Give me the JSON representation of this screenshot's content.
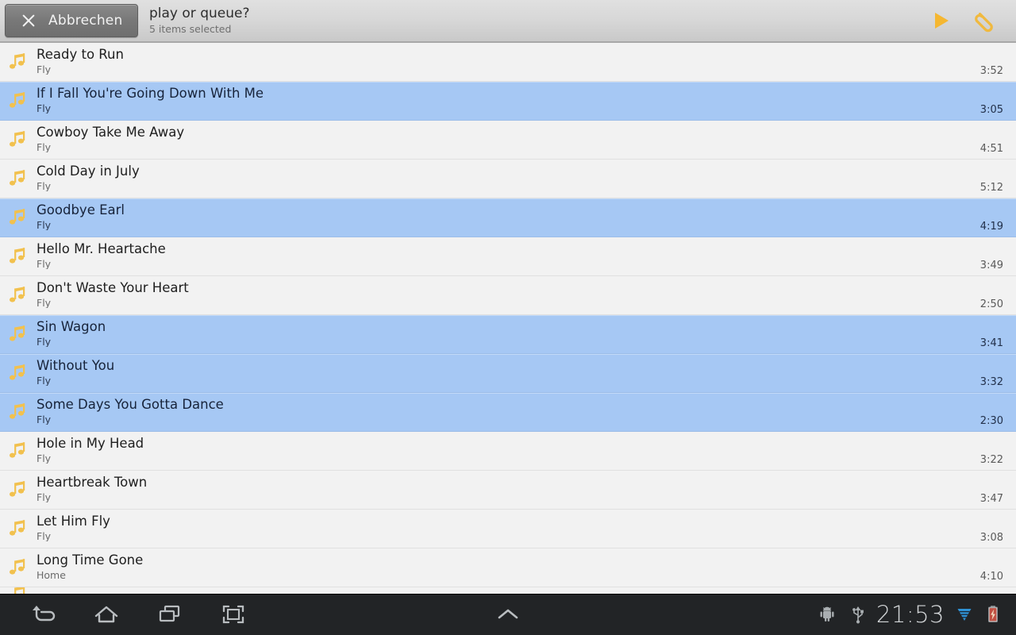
{
  "action_bar": {
    "cancel_label": "Abbrechen",
    "cancel_icon": "close-icon",
    "title": "play or queue?",
    "subtitle": "5 items selected",
    "play_icon": "play-icon",
    "attach_icon": "paperclip-icon",
    "accent_color": "#f5b731"
  },
  "colors": {
    "selection": "#a6c8f4",
    "row_bg": "#f2f2f2",
    "bar_bg": "#d6d6d6",
    "note_icon": "#f2c14e",
    "system_bar": "#222426"
  },
  "song_list": {
    "row_icon": "music-note-icon",
    "rows": [
      {
        "title": "Ready to Run",
        "album": "Fly",
        "duration": "3:52",
        "selected": false
      },
      {
        "title": "If I Fall You're Going Down With Me",
        "album": "Fly",
        "duration": "3:05",
        "selected": true
      },
      {
        "title": "Cowboy Take Me Away",
        "album": "Fly",
        "duration": "4:51",
        "selected": false
      },
      {
        "title": "Cold Day in July",
        "album": "Fly",
        "duration": "5:12",
        "selected": false
      },
      {
        "title": "Goodbye Earl",
        "album": "Fly",
        "duration": "4:19",
        "selected": true
      },
      {
        "title": "Hello Mr. Heartache",
        "album": "Fly",
        "duration": "3:49",
        "selected": false
      },
      {
        "title": "Don't Waste Your Heart",
        "album": "Fly",
        "duration": "2:50",
        "selected": false
      },
      {
        "title": "Sin Wagon",
        "album": "Fly",
        "duration": "3:41",
        "selected": true
      },
      {
        "title": "Without You",
        "album": "Fly",
        "duration": "3:32",
        "selected": true
      },
      {
        "title": "Some Days You Gotta Dance",
        "album": "Fly",
        "duration": "2:30",
        "selected": true
      },
      {
        "title": "Hole in My Head",
        "album": "Fly",
        "duration": "3:22",
        "selected": false
      },
      {
        "title": "Heartbreak Town",
        "album": "Fly",
        "duration": "3:47",
        "selected": false
      },
      {
        "title": "Let Him Fly",
        "album": "Fly",
        "duration": "3:08",
        "selected": false
      },
      {
        "title": "Long Time Gone",
        "album": "Home",
        "duration": "4:10",
        "selected": false
      }
    ]
  },
  "system_bar": {
    "back_icon": "back-arrow-icon",
    "home_icon": "home-icon",
    "recents_icon": "recent-apps-icon",
    "screenshot_icon": "fullscreen-icon",
    "menu_icon": "chevron-up-icon",
    "android_icon": "android-robot-icon",
    "usb_icon": "usb-icon",
    "clock": "21:53",
    "wifi_icon": "wifi-signal-icon",
    "battery_icon": "battery-charging-icon"
  }
}
